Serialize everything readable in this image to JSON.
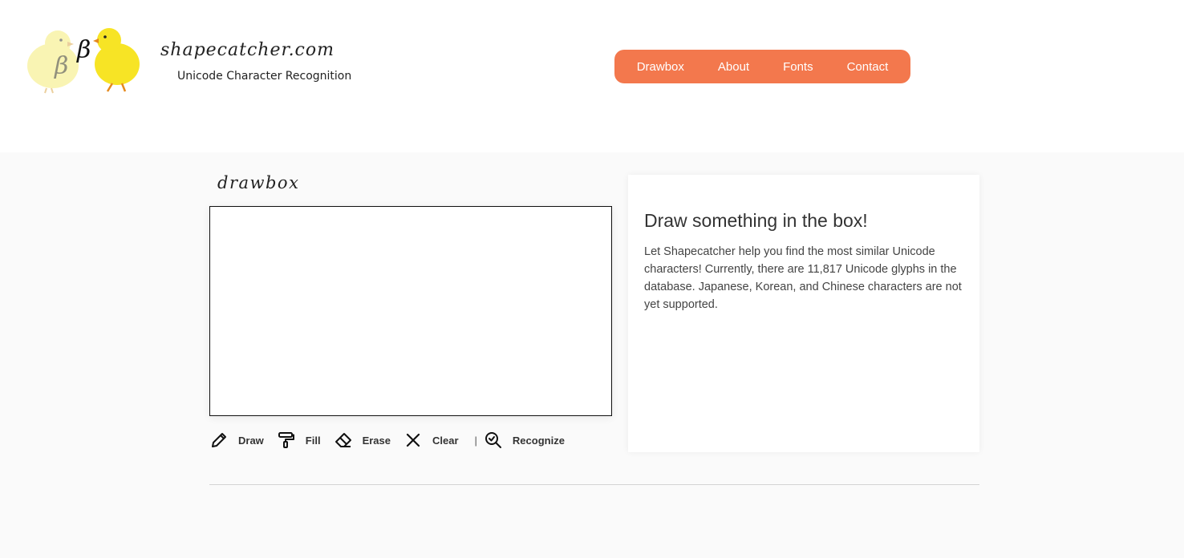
{
  "header": {
    "brand_name": "shapecatcher.com",
    "tagline": "Unicode Character Recognition",
    "logo_glyph": "β"
  },
  "nav": {
    "items": [
      {
        "label": "Drawbox"
      },
      {
        "label": "About"
      },
      {
        "label": "Fonts"
      },
      {
        "label": "Contact"
      }
    ],
    "color": "#f3784d"
  },
  "drawbox": {
    "title": "drawbox"
  },
  "toolbar": {
    "draw_label": "Draw",
    "fill_label": "Fill",
    "erase_label": "Erase",
    "clear_label": "Clear",
    "separator": "|",
    "recognize_label": "Recognize"
  },
  "info": {
    "heading": "Draw something in the box!",
    "body": "Let Shapecatcher help you find the most similar Unicode characters! Currently, there are 11,817 Unicode glyphs in the database. Japanese, Korean, and Chinese characters are not yet supported."
  },
  "icons": {
    "draw": "pencil-icon",
    "fill": "paint-roller-icon",
    "erase": "eraser-icon",
    "clear": "x-icon",
    "recognize": "magnifier-check-icon"
  }
}
